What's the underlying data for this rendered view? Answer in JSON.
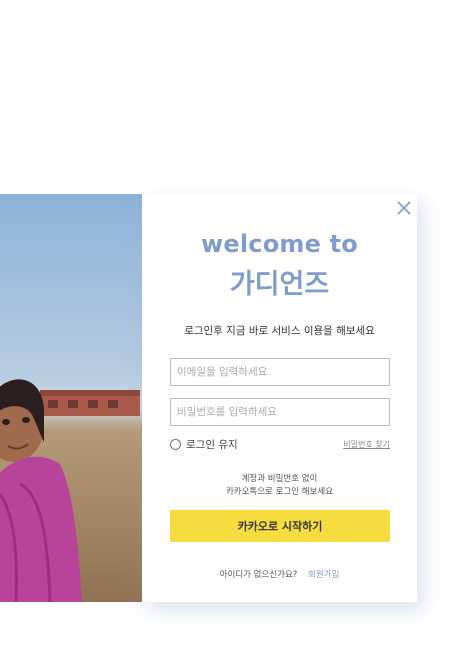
{
  "login": {
    "welcome": "welcome to",
    "brand": "가디언즈",
    "subtitle": "로그인후 지금 바로 서비스 이용을 해보세요",
    "email_placeholder": "이메일을 입력하세요",
    "password_placeholder": "비밀번호를 입력하세요",
    "keep_login": "로그인 유지",
    "find_password": "비밀번호 찾기",
    "note_line1": "계정과 비밀번호 없이",
    "note_line2": "카카오톡으로 로그인 해보세요",
    "kakao_button": "카카오로 시작하기",
    "no_account": "아이디가 없으신가요?",
    "signup": "회원가입"
  },
  "icons": {
    "close": "close-icon",
    "photo": "child-portrait-photo"
  },
  "colors": {
    "accent": "#7f9ccb",
    "kakao": "#f6dc3e"
  }
}
